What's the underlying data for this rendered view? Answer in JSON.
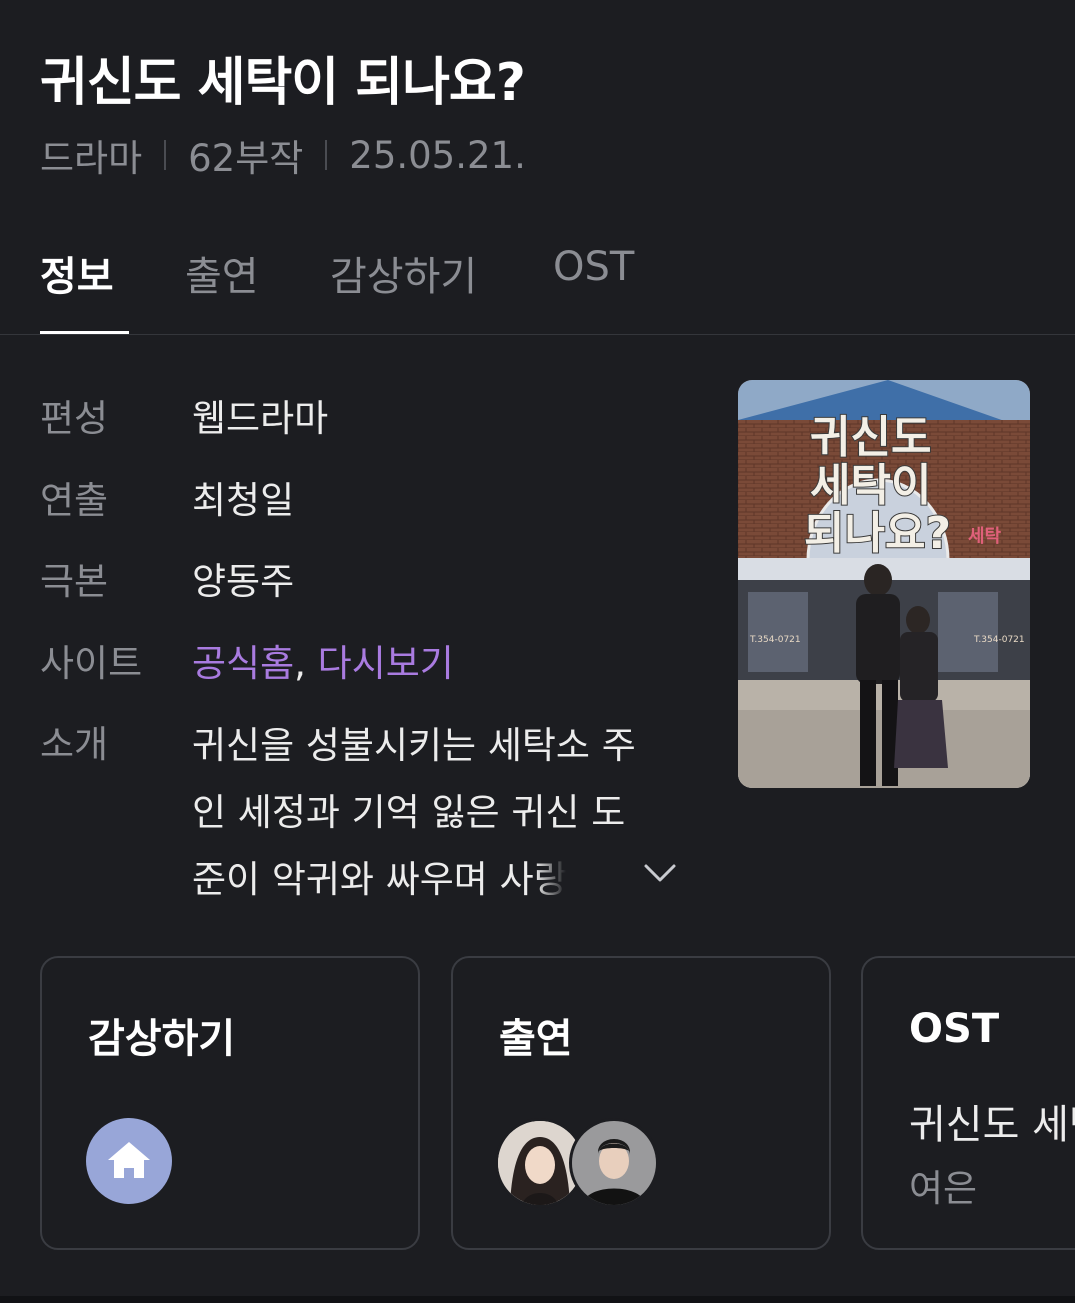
{
  "header": {
    "title": "귀신도 세탁이 되나요?",
    "meta": {
      "genre": "드라마",
      "episodes": "62부작",
      "date": "25.05.21."
    }
  },
  "tabs": [
    {
      "label": "정보",
      "active": true
    },
    {
      "label": "출연",
      "active": false
    },
    {
      "label": "감상하기",
      "active": false
    },
    {
      "label": "OST",
      "active": false
    }
  ],
  "info": {
    "format": {
      "label": "편성",
      "value": "웹드라마"
    },
    "director": {
      "label": "연출",
      "value": "최청일"
    },
    "writer": {
      "label": "극본",
      "value": "양동주"
    },
    "site": {
      "label": "사이트",
      "links": [
        "공식홈",
        "다시보기"
      ],
      "separator": ","
    },
    "synopsis": {
      "label": "소개",
      "lines": [
        "귀신을 성불시키는 세탁소 주",
        "인 세정과 기억 잃은 귀신 도",
        "준이 악귀와 싸우며 사랑을"
      ]
    }
  },
  "poster": {
    "title_lines": [
      "귀신도",
      "세탁이",
      "되나요?"
    ],
    "sign_text": "세탁",
    "store_phone": "T.354-0721"
  },
  "cards": {
    "watch": {
      "title": "감상하기",
      "icon": "home-icon"
    },
    "cast": {
      "title": "출연"
    },
    "ost": {
      "title": "OST",
      "track": "귀신도 세탁이 되나요?",
      "artist": "여은"
    }
  },
  "colors": {
    "background": "#1c1d21",
    "link": "#a97be0",
    "muted": "#8b8d93",
    "home_circle": "#98a6d8"
  }
}
